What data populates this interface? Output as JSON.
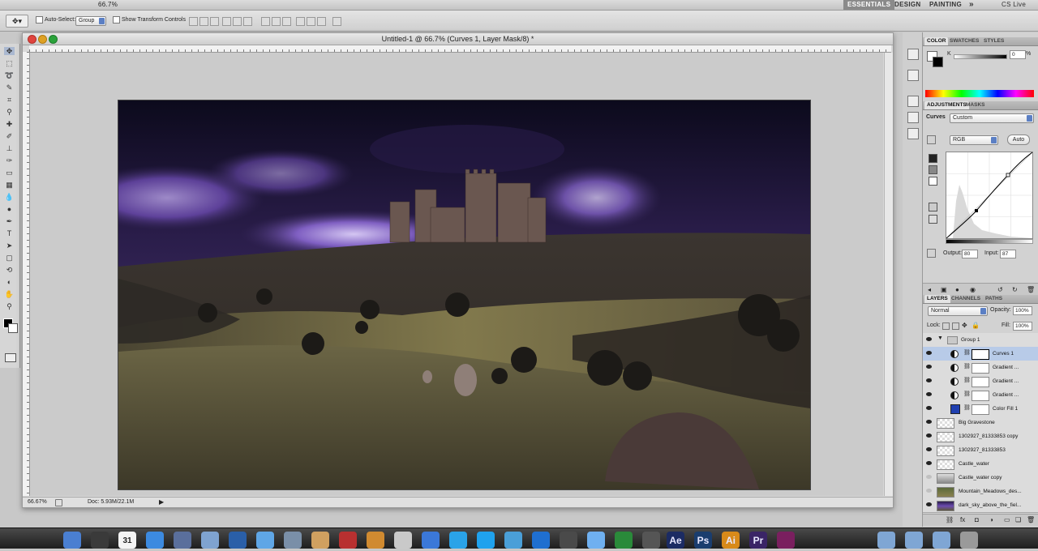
{
  "app_bar": {
    "zoom": "66.7%",
    "workspaces": [
      "ESSENTIALS",
      "DESIGN",
      "PAINTING"
    ],
    "more": "»",
    "cs_live": "CS Live"
  },
  "options_bar": {
    "auto_select_label": "Auto-Select:",
    "auto_select_value": "Group",
    "show_transform_label": "Show Transform Controls"
  },
  "document": {
    "title": "Untitled-1 @ 66.7% (Curves 1, Layer Mask/8) *",
    "zoom": "66.67%",
    "doc_size": "Doc: 5.93M/22.1M"
  },
  "color_panel": {
    "tabs": [
      "COLOR",
      "SWATCHES",
      "STYLES"
    ],
    "k_label": "K",
    "k_value": "0",
    "k_unit": "%"
  },
  "adjustments_panel": {
    "tabs": [
      "ADJUSTMENTS",
      "MASKS"
    ],
    "title": "Curves",
    "preset": "Custom",
    "channel": "RGB",
    "auto_button": "Auto",
    "output_label": "Output:",
    "output_value": "80",
    "input_label": "Input:",
    "input_value": "87"
  },
  "layers_panel": {
    "tabs": [
      "LAYERS",
      "CHANNELS",
      "PATHS"
    ],
    "blend_mode": "Normal",
    "opacity_label": "Opacity:",
    "opacity": "100%",
    "lock_label": "Lock:",
    "fill_label": "Fill:",
    "fill": "100%",
    "layers": [
      {
        "name": "Group 1",
        "kind": "group"
      },
      {
        "name": "Curves 1",
        "kind": "adjustment",
        "selected": true
      },
      {
        "name": "Gradient ...",
        "kind": "adjustment"
      },
      {
        "name": "Gradient ...",
        "kind": "adjustment"
      },
      {
        "name": "Gradient ...",
        "kind": "adjustment"
      },
      {
        "name": "Color Fill 1",
        "kind": "fill"
      },
      {
        "name": "Big Gravestone",
        "kind": "pixel"
      },
      {
        "name": "1302927_81333853 copy",
        "kind": "pixel"
      },
      {
        "name": "1302927_81333853",
        "kind": "pixel"
      },
      {
        "name": "Castle_water",
        "kind": "pixel"
      },
      {
        "name": "Castle_water copy",
        "kind": "pixel"
      },
      {
        "name": "Mountain_Meadows_des...",
        "kind": "pixel"
      },
      {
        "name": "dark_sky_above_the_fiel...",
        "kind": "pixel"
      }
    ]
  },
  "dock": {
    "apps": [
      "finder-icon",
      "dashboard-icon",
      "calendar-icon",
      "app-store-icon",
      "xcode-icon",
      "facetime-icon",
      "quicktime-icon",
      "safari-icon",
      "mail-icon",
      "preview-icon",
      "photo-booth-icon",
      "iphoto-icon",
      "pencil-icon",
      "chrome-icon",
      "twitter-icon",
      "skype-icon",
      "screen-icon",
      "dvd-icon",
      "final-cut-icon",
      "itunes-icon",
      "facetime-2-icon",
      "movie-icon"
    ],
    "adobe": [
      "Ae",
      "Ps",
      "Ai",
      "Pr"
    ],
    "calendar_day": "31"
  },
  "colors": {
    "selection": "#b8cbe8",
    "accent_blue": "#5b7fc4",
    "after_effects": "#1b2b63",
    "photoshop": "#1a3d6e",
    "illustrator": "#d88a1a",
    "premiere": "#3a2466"
  }
}
